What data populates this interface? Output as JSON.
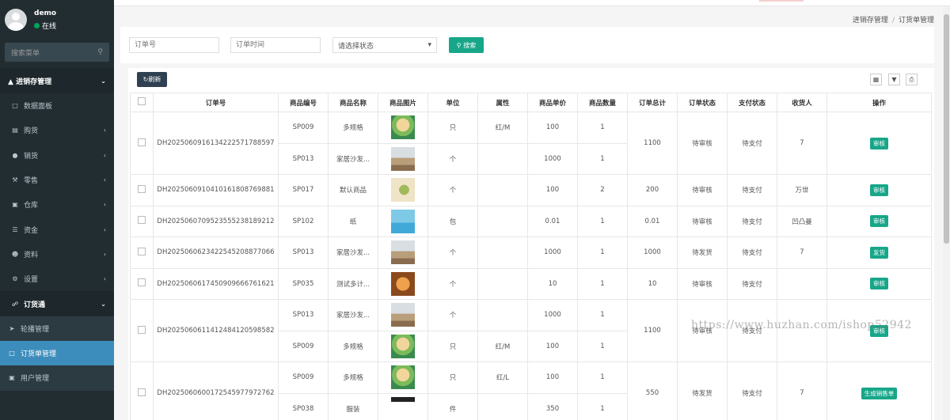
{
  "user": {
    "name": "demo",
    "status": "在线"
  },
  "sidebar": {
    "search_placeholder": "搜索菜单",
    "header": "进销存管理",
    "items": [
      {
        "label": "数据面板",
        "icon": "area-chart-icon"
      },
      {
        "label": "购货",
        "icon": "briefcase-icon"
      },
      {
        "label": "销货",
        "icon": "apple-icon"
      },
      {
        "label": "零售",
        "icon": "wrench-icon"
      },
      {
        "label": "仓库",
        "icon": "archive-icon"
      },
      {
        "label": "资金",
        "icon": "database-icon"
      },
      {
        "label": "资料",
        "icon": "users-icon"
      },
      {
        "label": "设置",
        "icon": "cogs-icon"
      }
    ],
    "group": "订货通",
    "subitems": [
      {
        "label": "轮播管理"
      },
      {
        "label": "订货单管理"
      },
      {
        "label": "用户管理"
      }
    ]
  },
  "breadcrumb": {
    "parent": "进销存管理",
    "sep": "/",
    "current": "订货单管理"
  },
  "filter": {
    "order_no_placeholder": "订单号",
    "order_time_placeholder": "订单时间",
    "status_placeholder": "请选择状态",
    "search_label": "搜索"
  },
  "toolbar": {
    "refresh_label": "刷新"
  },
  "table": {
    "headers": [
      "订单号",
      "商品编号",
      "商品名称",
      "商品图片",
      "单位",
      "属性",
      "商品单价",
      "商品数量",
      "订单总计",
      "订单状态",
      "支付状态",
      "收货人",
      "操作"
    ],
    "orders": [
      {
        "no": "DH20250609161342225717885​97",
        "items": [
          {
            "code": "SP009",
            "name": "多规格",
            "img": "doll",
            "unit": "只",
            "attr": "红/M",
            "price": "100",
            "qty": "1"
          },
          {
            "code": "SP013",
            "name": "家居沙发...",
            "img": "sofa",
            "unit": "个",
            "attr": "",
            "price": "1000",
            "qty": "1"
          }
        ],
        "total": "1100",
        "status": "待审核",
        "pay": "待支付",
        "receiver": "7",
        "action": "审核"
      },
      {
        "no": "DH20250609104101618087698​81",
        "items": [
          {
            "code": "SP017",
            "name": "默认商品",
            "img": "plant",
            "unit": "个",
            "attr": "",
            "price": "100",
            "qty": "2"
          }
        ],
        "total": "200",
        "status": "待审核",
        "pay": "待支付",
        "receiver": "万世",
        "action": "审核"
      },
      {
        "no": "DH20250607095235552381892​12",
        "items": [
          {
            "code": "SP102",
            "name": "纸",
            "img": "sea",
            "unit": "包",
            "attr": "",
            "price": "0.01",
            "qty": "1"
          }
        ],
        "total": "0.01",
        "status": "待审核",
        "pay": "待支付",
        "receiver": "凹凸曼",
        "action": "审核"
      },
      {
        "no": "DH20250606234225452088770​66",
        "items": [
          {
            "code": "SP013",
            "name": "家居沙发...",
            "img": "sofa",
            "unit": "个",
            "attr": "",
            "price": "1000",
            "qty": "1"
          }
        ],
        "total": "1000",
        "status": "待发货",
        "pay": "待支付",
        "receiver": "7",
        "action": "发货"
      },
      {
        "no": "DH20250606174509096667616​21",
        "items": [
          {
            "code": "SP035",
            "name": "测试多计...",
            "img": "face",
            "unit": "个",
            "attr": "",
            "price": "10",
            "qty": "1"
          }
        ],
        "total": "10",
        "status": "待审核",
        "pay": "待支付",
        "receiver": "",
        "action": "审核"
      },
      {
        "no": "DH20250606114124841205985​82",
        "items": [
          {
            "code": "SP013",
            "name": "家居沙发...",
            "img": "sofa",
            "unit": "个",
            "attr": "",
            "price": "1000",
            "qty": "1"
          },
          {
            "code": "SP009",
            "name": "多规格",
            "img": "doll",
            "unit": "只",
            "attr": "红/M",
            "price": "100",
            "qty": "1"
          }
        ],
        "total": "1100",
        "status": "待审核",
        "pay": "待支付",
        "receiver": "",
        "action": "审核"
      },
      {
        "no": "DH20250606001725459779727​62",
        "items": [
          {
            "code": "SP009",
            "name": "多规格",
            "img": "doll",
            "unit": "只",
            "attr": "红/L",
            "price": "100",
            "qty": "1"
          },
          {
            "code": "SP038",
            "name": "服装",
            "img": "dark",
            "unit": "件",
            "attr": "",
            "price": "350",
            "qty": "1"
          }
        ],
        "total": "550",
        "status": "待发货",
        "pay": "待支付",
        "receiver": "7",
        "action": "生成销售单"
      }
    ]
  },
  "watermark": "https://www.huzhan.com/ishop52942"
}
